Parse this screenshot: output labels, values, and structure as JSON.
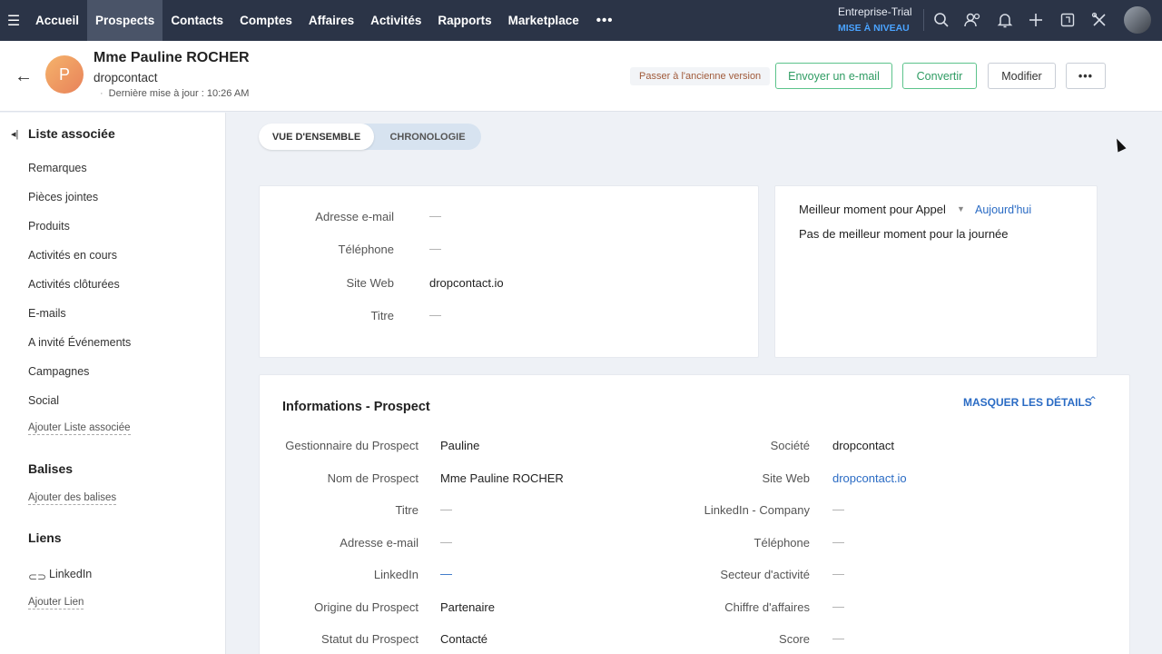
{
  "topnav": {
    "menu_icon": "hamburger-icon",
    "items": [
      {
        "label": "Accueil",
        "active": false
      },
      {
        "label": "Prospects",
        "active": true
      },
      {
        "label": "Contacts",
        "active": false
      },
      {
        "label": "Comptes",
        "active": false
      },
      {
        "label": "Affaires",
        "active": false
      },
      {
        "label": "Activités",
        "active": false
      },
      {
        "label": "Rapports",
        "active": false
      },
      {
        "label": "Marketplace",
        "active": false
      }
    ],
    "more": "•••",
    "trial_label": "Entreprise-Trial",
    "upgrade_label": "MISE À NIVEAU",
    "icons": [
      "search-icon",
      "contacts-icon",
      "bell-icon",
      "plus-icon",
      "calendar-icon",
      "tools-icon",
      "avatar"
    ]
  },
  "header": {
    "name": "Mme Pauline ROCHER",
    "company": "dropcontact",
    "avatar_letter": "P",
    "last_updated": "Dernière mise à jour : 10:26 AM",
    "old_version": "Passer à l'ancienne version",
    "buttons": {
      "email": "Envoyer un e-mail",
      "convert": "Convertir",
      "edit": "Modifier",
      "more": "•••"
    }
  },
  "sidebar": {
    "related_title": "Liste associée",
    "items": [
      "Remarques",
      "Pièces jointes",
      "Produits",
      "Activités en cours",
      "Activités clôturées",
      "E-mails",
      "A invité Événements",
      "Campagnes",
      "Social"
    ],
    "add_related": "Ajouter Liste associée",
    "tags_title": "Balises",
    "add_tags": "Ajouter des balises",
    "links_title": "Liens",
    "linkedin": "LinkedIn",
    "add_link": "Ajouter Lien"
  },
  "toggle": {
    "overview": "VUE D'ENSEMBLE",
    "timeline": "CHRONOLOGIE"
  },
  "summary": {
    "fields": [
      {
        "label": "Adresse e-mail",
        "value": "—",
        "empty": true
      },
      {
        "label": "Téléphone",
        "value": "—",
        "empty": true
      },
      {
        "label": "Site Web",
        "value": "dropcontact.io",
        "empty": false
      },
      {
        "label": "Titre",
        "value": "—",
        "empty": true
      }
    ]
  },
  "best_time": {
    "label": "Meilleur moment pour Appel",
    "day": "Aujourd'hui",
    "none": "Pas de meilleur moment pour la journée"
  },
  "info": {
    "title": "Informations - Prospect",
    "hide_details": "MASQUER LES DÉTAILS",
    "left": [
      {
        "label": "Gestionnaire du Prospect",
        "value": "Pauline"
      },
      {
        "label": "Nom de Prospect",
        "value": "Mme Pauline ROCHER"
      },
      {
        "label": "Titre",
        "value": "—"
      },
      {
        "label": "Adresse e-mail",
        "value": "—"
      },
      {
        "label": "LinkedIn",
        "value": "—"
      },
      {
        "label": "Origine du Prospect",
        "value": "Partenaire"
      },
      {
        "label": "Statut du Prospect",
        "value": "Contacté"
      }
    ],
    "right": [
      {
        "label": "Société",
        "value": "dropcontact"
      },
      {
        "label": "Site Web",
        "value": "dropcontact.io"
      },
      {
        "label": "LinkedIn - Company",
        "value": "—"
      },
      {
        "label": "Téléphone",
        "value": "—"
      },
      {
        "label": "Secteur d'activité",
        "value": "—"
      },
      {
        "label": "Chiffre d'affaires",
        "value": "—"
      },
      {
        "label": "Score",
        "value": "—"
      }
    ]
  },
  "colors": {
    "nav_bg": "#2b3447",
    "accent_blue": "#2a6bc4",
    "green": "#2f9c63"
  }
}
